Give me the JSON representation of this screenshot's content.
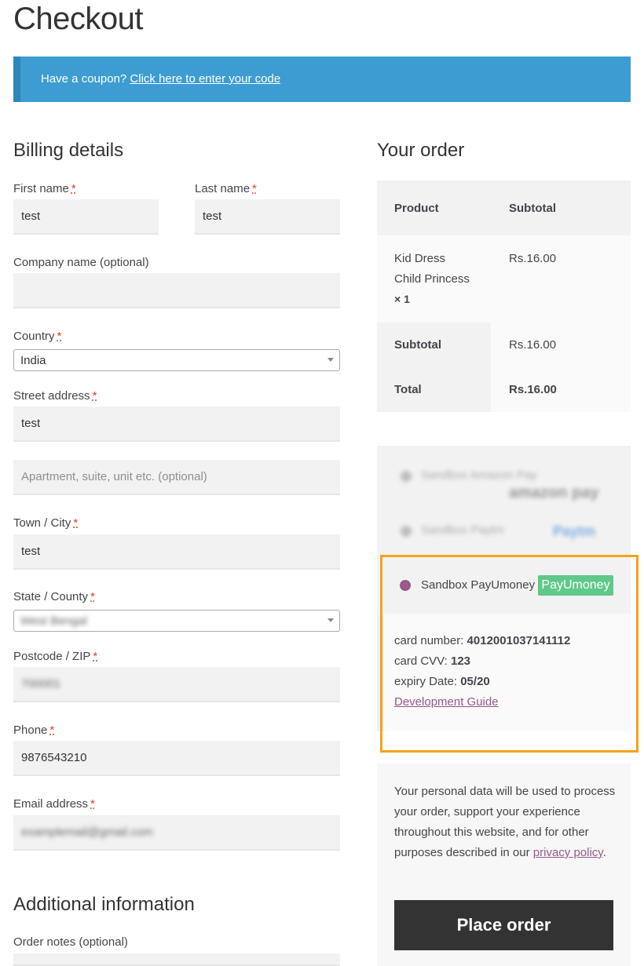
{
  "page": {
    "title": "Checkout"
  },
  "coupon": {
    "prompt": "Have a coupon?",
    "link": "Click here to enter your code"
  },
  "billing": {
    "heading": "Billing details",
    "required_mark": "*",
    "first_name": {
      "label": "First name",
      "value": "test"
    },
    "last_name": {
      "label": "Last name",
      "value": "test"
    },
    "company": {
      "label": "Company name (optional)",
      "value": ""
    },
    "country": {
      "label": "Country",
      "value": "India"
    },
    "street": {
      "label": "Street address",
      "value": "test",
      "placeholder2": "Apartment, suite, unit etc. (optional)"
    },
    "city": {
      "label": "Town / City",
      "value": "test"
    },
    "state": {
      "label": "State / County",
      "value": "West Bengal"
    },
    "postcode": {
      "label": "Postcode / ZIP",
      "value": "700001"
    },
    "phone": {
      "label": "Phone",
      "value": "9876543210"
    },
    "email": {
      "label": "Email address",
      "value": "examplemail@gmail.com"
    }
  },
  "additional": {
    "heading": "Additional information",
    "notes_label": "Order notes (optional)"
  },
  "order": {
    "heading": "Your order",
    "col_product": "Product",
    "col_subtotal": "Subtotal",
    "item_name_1": "Kid Dress",
    "item_name_2": "Child Princess",
    "item_qty": "× 1",
    "item_price": "Rs.16.00",
    "subtotal_label": "Subtotal",
    "subtotal_value": "Rs.16.00",
    "total_label": "Total",
    "total_value": "Rs.16.00"
  },
  "payment": {
    "method1": "Sandbox Amazon Pay",
    "method1_logo": "amazon pay",
    "method2": "Sandbox Paytm",
    "method2_logo": "Paytm",
    "method3": "Sandbox PayUmoney",
    "method3_logo": "PayUmoney",
    "card_number_label": "card number:",
    "card_number": "4012001037141112",
    "cvv_label": "card CVV:",
    "cvv": "123",
    "expiry_label": "expiry Date:",
    "expiry": "05/20",
    "guide_link": "Development Guide"
  },
  "privacy": {
    "text": "Your personal data will be used to process your order, support your experience throughout this website, and for other purposes described in our",
    "link": "privacy policy",
    "end": "."
  },
  "place_order": "Place order",
  "colors": {
    "accent": "#96588a",
    "info": "#3d9cd2",
    "highlight": "#f5a31a",
    "payu": "#5fc98a"
  }
}
